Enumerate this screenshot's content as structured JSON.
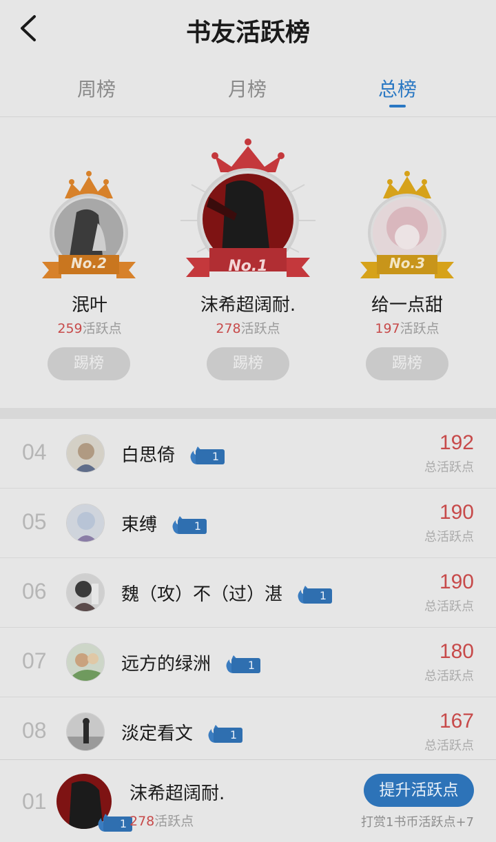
{
  "header": {
    "title": "书友活跃榜"
  },
  "tabs": [
    {
      "label": "周榜",
      "active": false
    },
    {
      "label": "月榜",
      "active": false
    },
    {
      "label": "总榜",
      "active": true
    }
  ],
  "podium": {
    "first": {
      "rank_label": "No.1",
      "name": "沫希超阔耐.",
      "points": "278",
      "points_unit": "活跃点",
      "button": "踢榜"
    },
    "second": {
      "rank_label": "No.2",
      "name": "泯叶",
      "points": "259",
      "points_unit": "活跃点",
      "button": "踢榜"
    },
    "third": {
      "rank_label": "No.3",
      "name": "给一点甜",
      "points": "197",
      "points_unit": "活跃点",
      "button": "踢榜"
    }
  },
  "list": [
    {
      "rank": "04",
      "name": "白思倚",
      "level": "1",
      "score": "192",
      "score_label": "总活跃点"
    },
    {
      "rank": "05",
      "name": "束缚",
      "level": "1",
      "score": "190",
      "score_label": "总活跃点"
    },
    {
      "rank": "06",
      "name": "魏（攻）不（过）湛",
      "level": "1",
      "score": "190",
      "score_label": "总活跃点"
    },
    {
      "rank": "07",
      "name": "远方的绿洲",
      "level": "1",
      "score": "180",
      "score_label": "总活跃点"
    },
    {
      "rank": "08",
      "name": "淡定看文",
      "level": "1",
      "score": "167",
      "score_label": "总活跃点"
    }
  ],
  "me": {
    "rank": "01",
    "name": "沫希超阔耐.",
    "level": "1",
    "points": "278",
    "points_unit": "活跃点",
    "boost_button": "提升活跃点",
    "hint": "打赏1书币活跃点+7"
  },
  "colors": {
    "accent": "#2a78c3",
    "score": "#c74a4a",
    "crown_gold": "#d6a21a",
    "crown_red": "#c4383c",
    "crown_orange": "#d7812a"
  },
  "icons": [
    "chevron-left-icon",
    "crown-icon",
    "flame-icon"
  ]
}
